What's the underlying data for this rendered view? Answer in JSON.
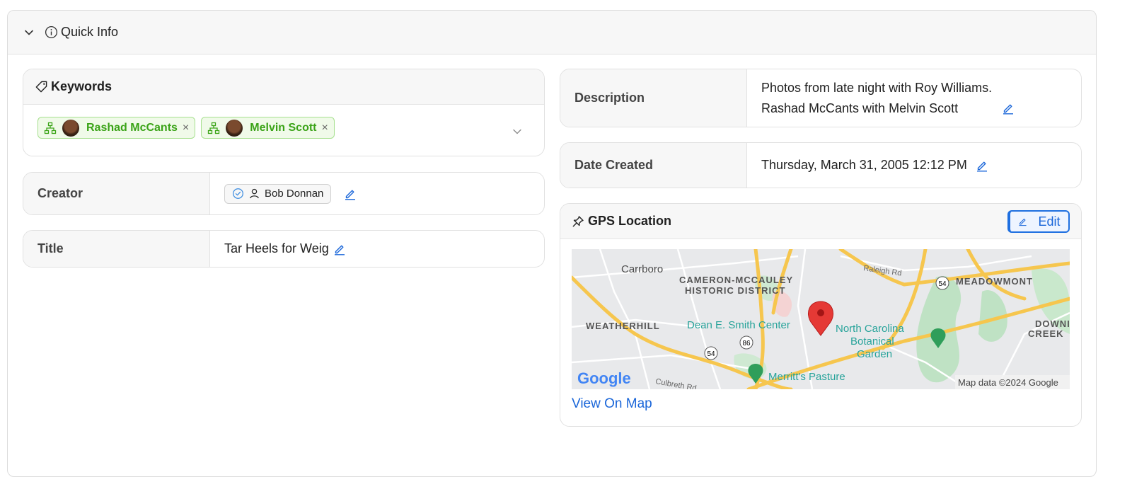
{
  "panel": {
    "title": "Quick Info",
    "chevron_icon": "chevron-down-icon",
    "info_icon": "info-icon"
  },
  "keywords": {
    "title": "Keywords",
    "tags": [
      {
        "label": "Rashad McCants",
        "remove": "×"
      },
      {
        "label": "Melvin Scott",
        "remove": "×"
      }
    ],
    "colors": {
      "chip_text": "#3aa317",
      "chip_border": "#a6e08e",
      "chip_bg": "#f0fae9"
    }
  },
  "creator": {
    "label": "Creator",
    "value": "Bob Donnan"
  },
  "title_field": {
    "label": "Title",
    "value": "Tar Heels for Weig"
  },
  "description": {
    "label": "Description",
    "line1": "Photos from late night with Roy Williams.",
    "line2": "Rashad McCants with Melvin Scott"
  },
  "date_created": {
    "label": "Date Created",
    "value": "Thursday, March 31, 2005 12:12 PM"
  },
  "gps": {
    "title": "GPS Location",
    "edit_label": "Edit",
    "view_on_map": "View On Map",
    "map": {
      "places": {
        "carrboro": "Carrboro",
        "cameron_1": "CAMERON-MCCAULEY",
        "cameron_2": "HISTORIC DISTRICT",
        "meadowmont": "MEADOWMONT",
        "weatherhill": "WEATHERHILL",
        "dean": "Dean E. Smith Center",
        "ncbg_1": "North Carolina",
        "ncbg_2": "Botanical",
        "ncbg_3": "Garden",
        "downing_1": "DOWNING",
        "downing_2": "CREEK",
        "merritt": "Merritt's Pasture",
        "raleigh": "Raleigh Rd",
        "culbreth": "Culbreth Rd",
        "r54a": "54",
        "r54b": "54",
        "r86": "86",
        "google": "Google",
        "attribution": "Map data ©2024 Google"
      }
    }
  },
  "accent": "#1a66d9"
}
